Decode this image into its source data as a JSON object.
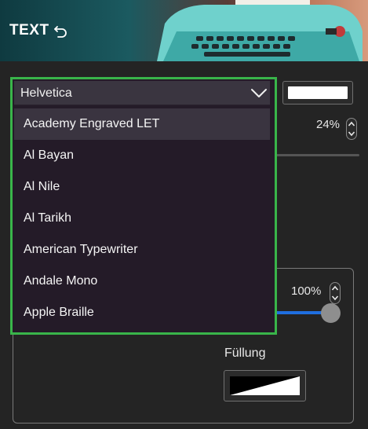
{
  "header": {
    "title": "TEXT",
    "undo_icon": "undo-icon",
    "hero_image": "typewriter-illustration"
  },
  "font_dropdown": {
    "selected": "Helvetica",
    "chevron_icon": "chevron-down-icon",
    "options": [
      "Academy Engraved LET",
      "Al Bayan",
      "Al Nile",
      "Al Tarikh",
      "American Typewriter",
      "Andale Mono",
      "Apple Braille"
    ],
    "highlighted_index": 0,
    "outline_color": "#39b54a"
  },
  "text_color": {
    "value": "#ffffff"
  },
  "opacity_top": {
    "value": "24%"
  },
  "opacity_bottom": {
    "value": "100%"
  },
  "slider": {
    "value": 1.0,
    "accent": "#1f6fe0"
  },
  "fill": {
    "label": "Füllung"
  }
}
